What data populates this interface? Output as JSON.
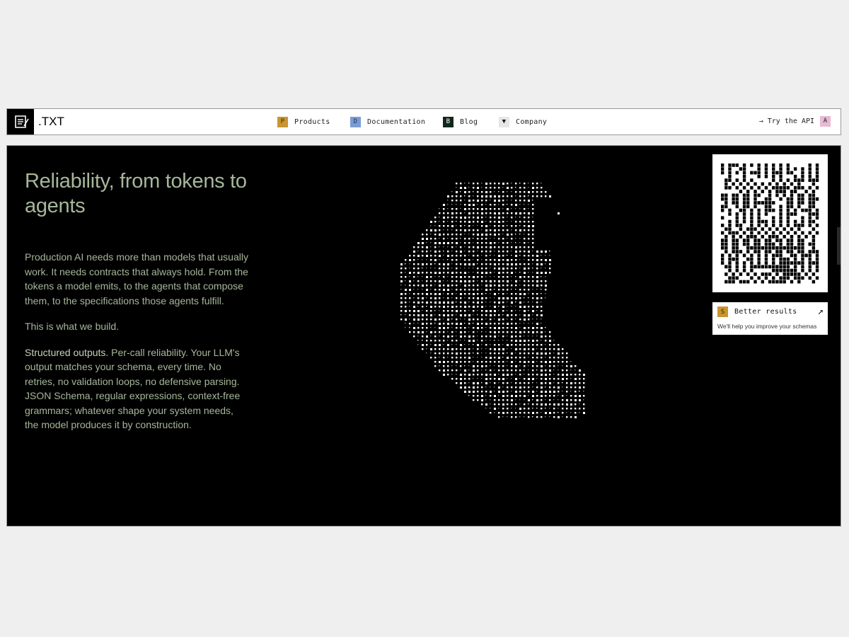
{
  "header": {
    "brand": ".TXT",
    "nav": [
      {
        "key": "P",
        "label": "Products",
        "color": "#c8962f",
        "key_text_color": "#3a2a00"
      },
      {
        "key": "D",
        "label": "Documentation",
        "color": "#7a9bd4",
        "key_text_color": "#1d2d55"
      },
      {
        "key": "B",
        "label": "Blog",
        "color": "#10281c",
        "key_text_color": "#ffffff"
      },
      {
        "key": "▼",
        "label": "Company",
        "color": "#e6e6e6",
        "key_text_color": "#111111"
      }
    ],
    "cta": {
      "label": "→ Try the API",
      "key": "A",
      "color": "#e8b9d2"
    }
  },
  "hero": {
    "headline": "Reliability, from tokens to agents",
    "paragraphs": [
      "Production AI needs more than models that usually work. It needs contracts that always hold. From the tokens a model emits, to the agents that compose them, to the specifications those agents fulfill.",
      "This is what we build."
    ],
    "feature": {
      "title": "Structured outputs.",
      "text": " Per-call reliability. Your LLM's output matches your schema, every time. No retries, no validation loops, no defensive parsing. JSON Schema, regular expressions, context-free grammars; whatever shape your system needs, the model produces it by construction."
    }
  },
  "card": {
    "key": "S",
    "title": "Better results",
    "subtitle": "We'll help you improve your schemas",
    "arrow_icon": "arrow-up-right-icon"
  },
  "colors": {
    "accent_green": "#a6b79a",
    "background": "#000000"
  }
}
